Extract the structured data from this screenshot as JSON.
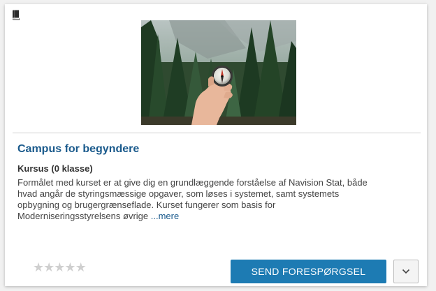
{
  "card": {
    "type_icon": "book-icon",
    "image_subject": "hand holding compass in forest",
    "title": "Campus for begyndere",
    "subtitle": "Kursus (0 klasse)",
    "description_lines": [
      "Formålet med kurset er at give dig en grundlæggende forståelse af Navision Stat, både",
      "hvad angår de styringsmæssige opgaver, som løses i systemet, samt systemets",
      "opbygning og brugergrænseflade. Kurset fungerer som basis for",
      "Moderniseringsstyrelsens øvrige"
    ],
    "more_link": "...mere",
    "rating": {
      "value": 0,
      "max": 5,
      "star_glyph": "★",
      "color": "#cfcfcf"
    },
    "send_button": "SEND FORESPØRGSEL",
    "dropdown_icon": "chevron-down-icon",
    "colors": {
      "title": "#1a5a8c",
      "button": "#1d7bb3",
      "link": "#1a5a8c"
    }
  }
}
